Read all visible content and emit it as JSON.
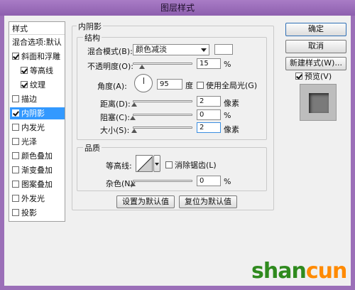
{
  "title": "图层样式",
  "left_list": {
    "header": "样式",
    "items": [
      {
        "label": "混合选项:默认",
        "checkbox": false,
        "checked": false,
        "selected": false,
        "indent": 0
      },
      {
        "label": "斜面和浮雕",
        "checkbox": true,
        "checked": true,
        "selected": false,
        "indent": 0
      },
      {
        "label": "等高线",
        "checkbox": true,
        "checked": true,
        "selected": false,
        "indent": 1
      },
      {
        "label": "纹理",
        "checkbox": true,
        "checked": true,
        "selected": false,
        "indent": 1
      },
      {
        "label": "描边",
        "checkbox": true,
        "checked": false,
        "selected": false,
        "indent": 0
      },
      {
        "label": "内阴影",
        "checkbox": true,
        "checked": true,
        "selected": true,
        "indent": 0
      },
      {
        "label": "内发光",
        "checkbox": true,
        "checked": false,
        "selected": false,
        "indent": 0
      },
      {
        "label": "光泽",
        "checkbox": true,
        "checked": false,
        "selected": false,
        "indent": 0
      },
      {
        "label": "颜色叠加",
        "checkbox": true,
        "checked": false,
        "selected": false,
        "indent": 0
      },
      {
        "label": "渐变叠加",
        "checkbox": true,
        "checked": false,
        "selected": false,
        "indent": 0
      },
      {
        "label": "图案叠加",
        "checkbox": true,
        "checked": false,
        "selected": false,
        "indent": 0
      },
      {
        "label": "外发光",
        "checkbox": true,
        "checked": false,
        "selected": false,
        "indent": 0
      },
      {
        "label": "投影",
        "checkbox": true,
        "checked": false,
        "selected": false,
        "indent": 0
      }
    ]
  },
  "panel": {
    "title": "内阴影",
    "structure": {
      "legend": "结构",
      "blend_mode_label": "混合模式(B):",
      "blend_mode_value": "颜色减淡",
      "opacity_label": "不透明度(O):",
      "opacity_value": "15",
      "opacity_unit": "%",
      "opacity_fraction": 0.15,
      "angle_label": "角度(A):",
      "angle_value": "95",
      "angle_unit": "度",
      "global_light_label": "使用全局光(G)",
      "distance_label": "距离(D):",
      "distance_value": "2",
      "distance_unit": "像素",
      "distance_fraction": 0.02,
      "choke_label": "阻塞(C):",
      "choke_value": "0",
      "choke_unit": "%",
      "choke_fraction": 0.0,
      "size_label": "大小(S):",
      "size_value": "2",
      "size_unit": "像素",
      "size_fraction": 0.02
    },
    "quality": {
      "legend": "品质",
      "contour_label": "等高线:",
      "antialias_label": "消除锯齿(L)",
      "noise_label": "杂色(N):",
      "noise_value": "0",
      "noise_unit": "%",
      "noise_fraction": 0.0
    },
    "set_default": "设置为默认值",
    "reset_default": "复位为默认值"
  },
  "right": {
    "ok": "确定",
    "cancel": "取消",
    "new_style": "新建样式(W)...",
    "preview_label": "预览(V)"
  },
  "watermark": {
    "text_a": "shan",
    "text_b": "cun",
    "text_c": ".net",
    "sub": "山村网"
  }
}
